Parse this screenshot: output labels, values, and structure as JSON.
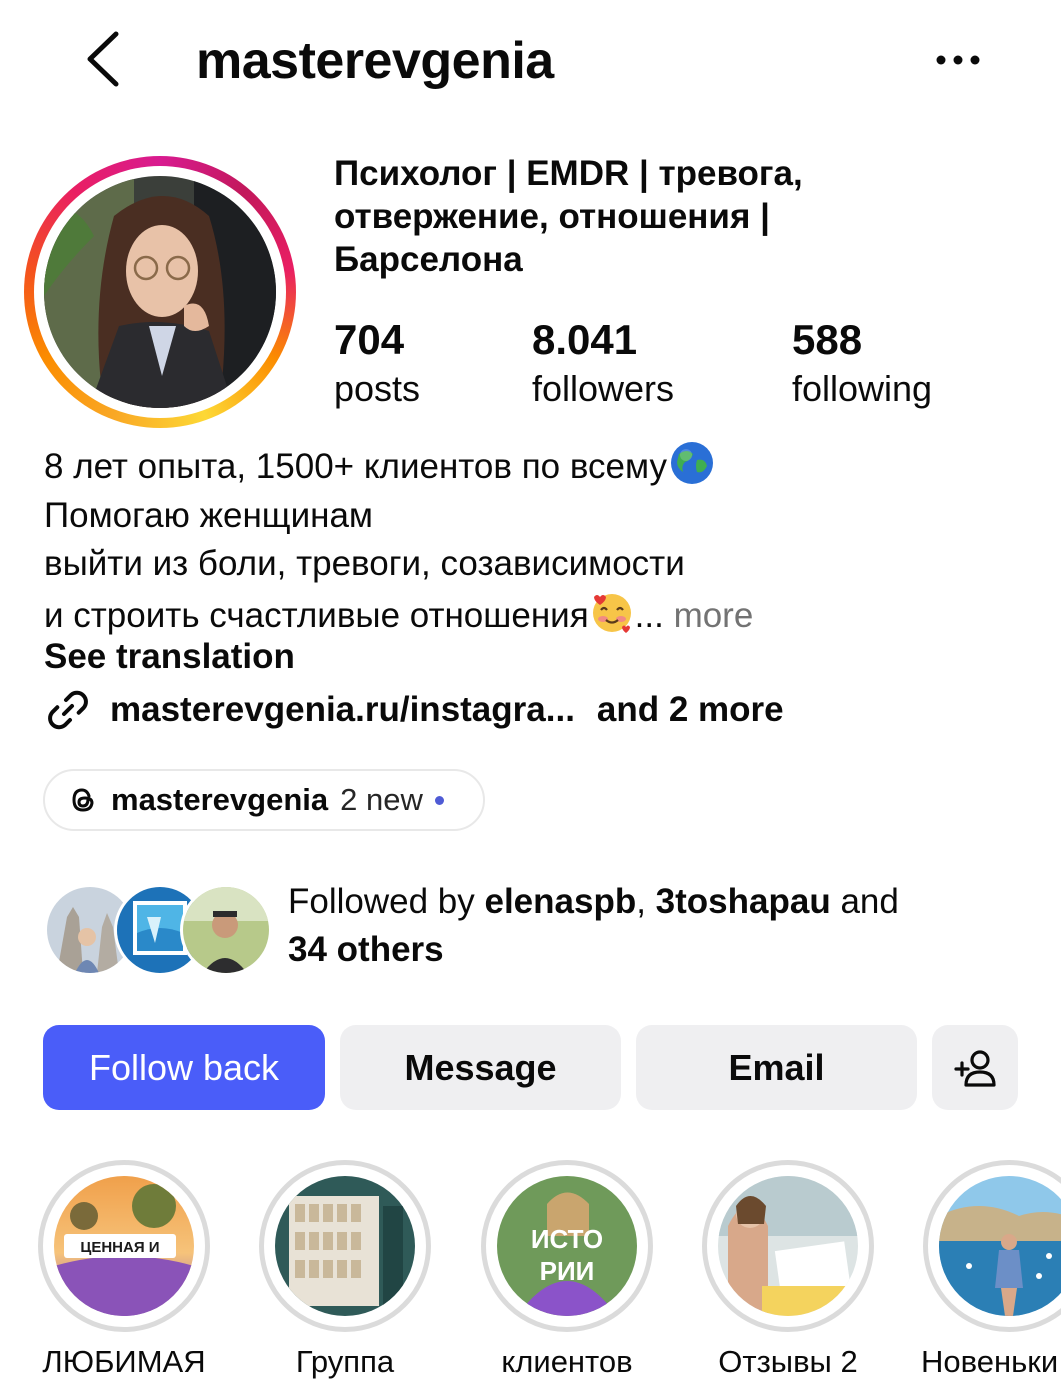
{
  "header": {
    "username": "masterevgenia"
  },
  "profile": {
    "category_lines": [
      "Психолог | EMDR | тревога,",
      "отвержение, отношения |",
      "Барселона"
    ],
    "stats": {
      "posts": {
        "value": "704",
        "label": "posts"
      },
      "followers": {
        "value": "8.041",
        "label": "followers"
      },
      "following": {
        "value": "588",
        "label": "following"
      }
    },
    "bio_lines": [
      "8 лет опыта, 1500+ клиентов по всему",
      "Помогаю женщинам",
      "выйти из боли, тревоги, созависимости",
      "и строить счастливые отношения"
    ],
    "bio_ellipsis": "... ",
    "bio_more": "more",
    "see_translation": "See translation",
    "link": {
      "url": "masterevgenia.ru/instagra...",
      "more": "and 2 more"
    },
    "threads": {
      "name": "masterevgenia",
      "new": "2 new"
    },
    "followed_by": {
      "prefix": "Followed by ",
      "user1": "elenaspb",
      "sep": ", ",
      "user2": "3toshapau",
      "and": " and",
      "others": "34 others"
    }
  },
  "actions": {
    "follow_back": "Follow back",
    "message": "Message",
    "email": "Email"
  },
  "highlights": [
    {
      "label": "ЛЮБИМАЯ",
      "overlay": "ЦЕННАЯ И"
    },
    {
      "label": "Группа",
      "overlay": ""
    },
    {
      "label": "клиентов",
      "overlay": "ИСТО РИИ"
    },
    {
      "label": "Отзывы 2",
      "overlay": ""
    },
    {
      "label": "Новеньки",
      "overlay": ""
    }
  ],
  "colors": {
    "primary_button": "#4a5df9",
    "secondary_button": "#efeff1",
    "muted_text": "#737373"
  }
}
